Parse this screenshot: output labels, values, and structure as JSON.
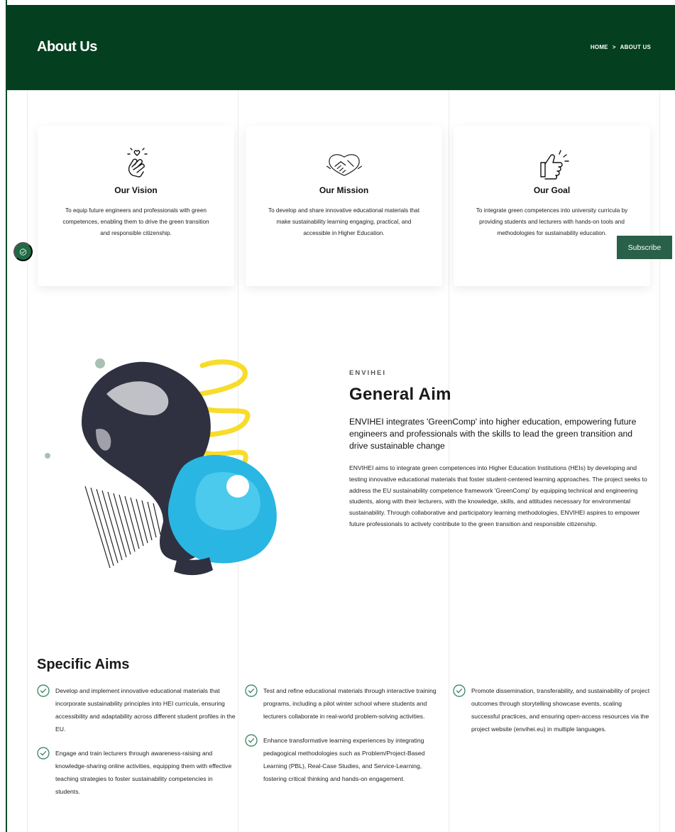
{
  "header": {
    "title": "About Us",
    "breadcrumb_home": "HOME",
    "breadcrumb_sep": ">",
    "breadcrumb_current": "ABOUT US",
    "bg_color": "#04401f"
  },
  "cards": [
    {
      "icon": "hand-heart-icon",
      "title": "Our Vision",
      "text": "To equip future engineers and professionals with green competences, enabling them to drive the green transition and responsible citizenship."
    },
    {
      "icon": "handshake-icon",
      "title": "Our Mission",
      "text": "To develop and share innovative educational materials that make sustainability learning engaging, practical, and accessible in Higher Education."
    },
    {
      "icon": "thumbs-up-icon",
      "title": "Our Goal",
      "text": "To integrate green competences into university curricula by providing students and lecturers with hands-on tools and methodologies for sustainability education."
    }
  ],
  "floating": {
    "accessibility_icon": "accessibility-icon",
    "subscribe_label": "Subscribe",
    "subscribe_color": "#29604a"
  },
  "general_aim": {
    "eyebrow": "ENVIHEI",
    "title": "General  Aim",
    "lead": "ENVIHEI integrates 'GreenComp' into higher education, empowering future engineers and professionals with the skills to lead the green transition and drive sustainable change",
    "body": "ENVIHEI aims to integrate green competences into Higher Education Institutions (HEIs) by developing and testing innovative educational materials that foster student-centered learning approaches. The project seeks to address the EU sustainability competence framework 'GreenComp' by equipping technical and engineering students, along with their lecturers, with the knowledge, skills, and attitudes necessary for environmental sustainability. Through collaborative and participatory learning methodologies, ENVIHEI aspires to empower future professionals to actively contribute to the green transition and responsible citizenship.",
    "illustration": "lightbulb-collage-illustration"
  },
  "specific_aims": {
    "title": "Specific Aims",
    "check_color": "#2a7a55",
    "columns": [
      [
        "Develop and implement innovative educational materials that incorporate sustainability principles into HEI curricula, ensuring accessibility and adaptability across different student profiles in the EU.",
        "Engage and train lecturers through awareness-raising and knowledge-sharing online activities, equipping them with effective teaching strategies to foster sustainability competencies in students."
      ],
      [
        "Test and refine educational materials through interactive training programs, including a pilot winter school where students and lecturers collaborate in real-world problem-solving activities.",
        "Enhance transformative learning experiences by integrating pedagogical methodologies such as Problem/Project-Based Learning (PBL), Real-Case Studies, and Service-Learning, fostering critical thinking and hands-on engagement."
      ],
      [
        "Promote dissemination, transferability, and sustainability of project outcomes through storytelling showcase events, scaling successful practices, and ensuring open-access resources via the project website (envihei.eu) in multiple languages."
      ]
    ]
  }
}
